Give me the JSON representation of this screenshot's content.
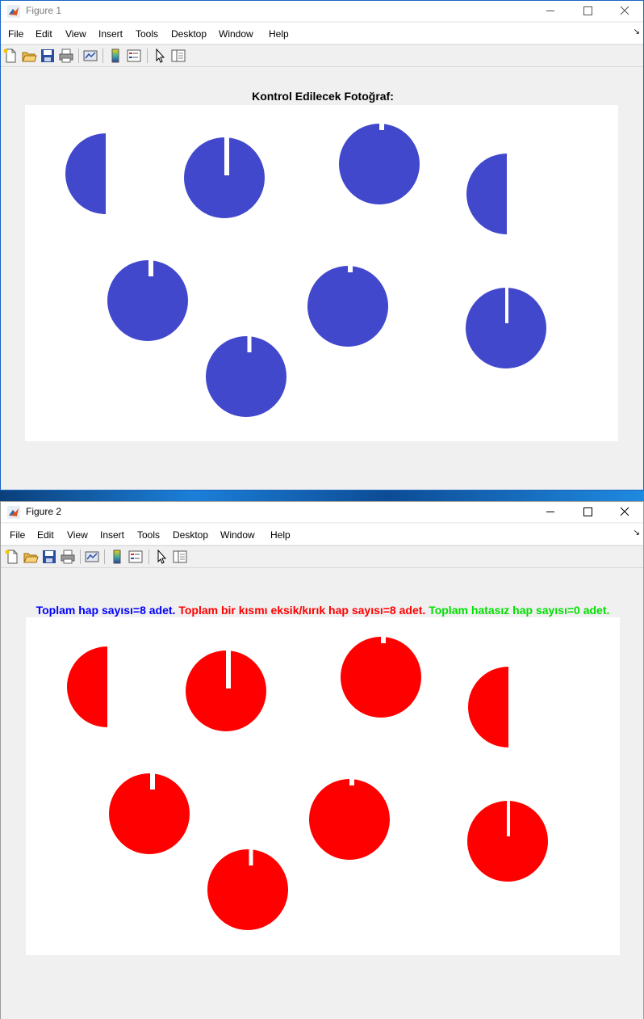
{
  "colors": {
    "pill_blue": "#4248cc",
    "pill_red": "#ff0000",
    "summary_blue": "#0000ff",
    "summary_red": "#ff0000",
    "summary_green": "#00e000"
  },
  "menu": [
    "File",
    "Edit",
    "View",
    "Insert",
    "Tools",
    "Desktop",
    "Window",
    "Help"
  ],
  "toolbar_icons": [
    "new-figure-icon",
    "open-file-icon",
    "save-icon",
    "print-icon",
    "link-plot-icon",
    "insert-colorbar-icon",
    "insert-legend-icon",
    "edit-plot-icon",
    "property-inspector-icon"
  ],
  "figure1": {
    "window_title": "Figure 1",
    "axes_title": "Kontrol Edilecek Fotoğraf:",
    "pills": [
      "half",
      "notch",
      "notch",
      "half",
      "notch",
      "notch",
      "notch",
      "notch"
    ]
  },
  "figure2": {
    "window_title": "Figure 2",
    "summary": {
      "total": "Toplam hap sayısı=8 adet.",
      "defective": "Toplam bir kısmı eksik/kırık hap sayısı=8 adet.",
      "flawless": "Toplam hatasız hap sayısı=0 adet."
    },
    "pills": [
      "half",
      "notch",
      "notch",
      "half",
      "notch",
      "notch",
      "notch",
      "notch"
    ]
  }
}
